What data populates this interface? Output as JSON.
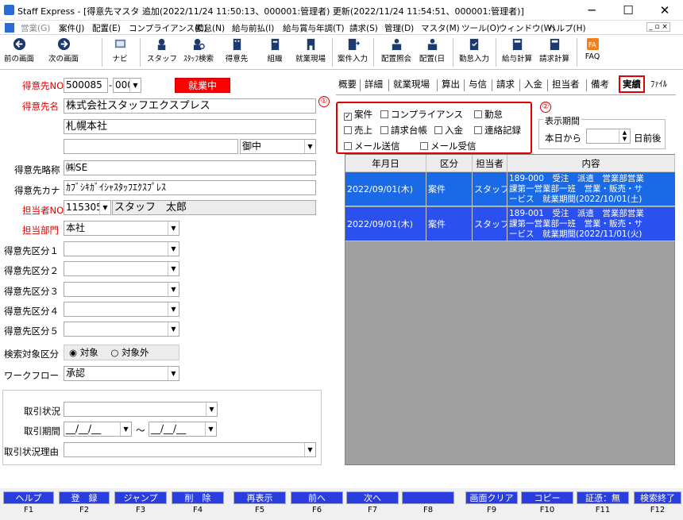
{
  "window": {
    "title": "Staff Express - [得意先マスタ 追加(2022/11/24 11:50:13、000001:管理者) 更新(2022/11/24 11:54:51、000001:管理者)]",
    "minimize": "─",
    "maximize": "☐",
    "close": "✕"
  },
  "menu": [
    "営業(G)",
    "案件(J)",
    "配置(E)",
    "コンプライアンス(C)",
    "勤怠(N)",
    "給与前払(I)",
    "給与賞与年調(T)",
    "請求(S)",
    "管理(D)",
    "マスタ(M)",
    "ツール(O)",
    "ウィンドウ(W)",
    "ヘルプ(H)"
  ],
  "toolbar": {
    "prev": "前の画面",
    "next": "次の画面",
    "navi": "ナビ",
    "staff": "スタッフ",
    "staff_search": "ｽﾀｯﾌ検索",
    "customer": "得意先",
    "org": "組織",
    "site": "就業現場",
    "job_entry": "案件入力",
    "placement_inquiry": "配置照会",
    "placement_day": "配置(日",
    "attendance": "勤怠入力",
    "pay_calc": "給与計算",
    "bill_calc": "請求計算",
    "faq": "FAQ"
  },
  "form": {
    "customer_no_label": "得意先NO",
    "customer_no": "500085",
    "branch_no": "000",
    "status_badge": "就業中",
    "customer_name_label": "得意先名",
    "customer_name": "株式会社スタッフエクスプレス",
    "customer_name2": "札幌本社",
    "customer_name3": "",
    "honorific": "御中",
    "short_name_label": "得意先略称",
    "short_name": "㈱SE",
    "kana_label": "得意先カナ",
    "kana": "ｶﾌﾞｼｷｶﾞｲｼｬｽﾀｯﾌｴｸｽﾌﾟﾚｽ",
    "rep_no_label": "担当者NO",
    "rep_no": "115305",
    "rep_name": "スタッフ　太郎",
    "dept_label": "担当部門",
    "dept": "本社",
    "cat1_label": "得意先区分１",
    "cat2_label": "得意先区分２",
    "cat3_label": "得意先区分３",
    "cat4_label": "得意先区分４",
    "cat5_label": "得意先区分５",
    "search_label": "検索対象区分",
    "search_opt1": "対象",
    "search_opt2": "対象外",
    "workflow_label": "ワークフロー",
    "workflow": "承認",
    "trade_status_label": "取引状況",
    "trade_period_label": "取引期間",
    "date_from": "__/__/__",
    "date_to": "__/__/__",
    "tilde": "～",
    "trade_reason_label": "取引状況理由"
  },
  "tabs": [
    "概要",
    "詳細",
    "就業現場",
    "算出",
    "与信",
    "請求",
    "入金",
    "担当者",
    "備考",
    "実績",
    "ﾌｧｲﾙ"
  ],
  "filters": {
    "jobs": "案件",
    "compliance": "コンプライアンス",
    "attendance": "勤怠",
    "sales": "売上",
    "billing_ledger": "請求台帳",
    "payment": "入金",
    "contact_log": "連絡記録",
    "mail_sent": "メール送信",
    "mail_received": "メール受信"
  },
  "period": {
    "group_label": "表示期間",
    "from_label": "本日から",
    "value": "",
    "suffix": "日前後"
  },
  "annotations": {
    "one": "①",
    "two": "②"
  },
  "grid": {
    "headers": [
      "年月日",
      "区分",
      "担当者",
      "内容"
    ],
    "rows": [
      {
        "date": "2022/09/01(木)",
        "type": "案件",
        "rep": "スタッフ",
        "content1": "189-000　受注　派遣　営業部営業",
        "content2": "課第一営業部一班　営業・販売・サ",
        "content3": "ービス　就業期間(2022/10/01(土)"
      },
      {
        "date": "2022/09/01(木)",
        "type": "案件",
        "rep": "スタッフ",
        "content1": "189-001　受注　派遣　営業部営業",
        "content2": "課第一営業部一班　営業・販売・サ",
        "content3": "ービス　就業期間(2022/11/01(火)"
      }
    ]
  },
  "fkeys": [
    {
      "label": "ヘルプ",
      "key": "F1"
    },
    {
      "label": "登　録",
      "key": "F2"
    },
    {
      "label": "ジャンプ",
      "key": "F3"
    },
    {
      "label": "削　除",
      "key": "F4"
    },
    {
      "label": "再表示",
      "key": "F5"
    },
    {
      "label": "前へ",
      "key": "F6"
    },
    {
      "label": "次へ",
      "key": "F7"
    },
    {
      "label": "",
      "key": "F8"
    },
    {
      "label": "画面クリア",
      "key": "F9"
    },
    {
      "label": "コピー",
      "key": "F10"
    },
    {
      "label": "証憑：無",
      "key": "F11"
    },
    {
      "label": "検索終了",
      "key": "F12"
    }
  ],
  "colors": {
    "grid_row": "#2060e0",
    "fkey": "#2a3ee0",
    "badge": "#ff0000",
    "annotation": "#e00000"
  }
}
